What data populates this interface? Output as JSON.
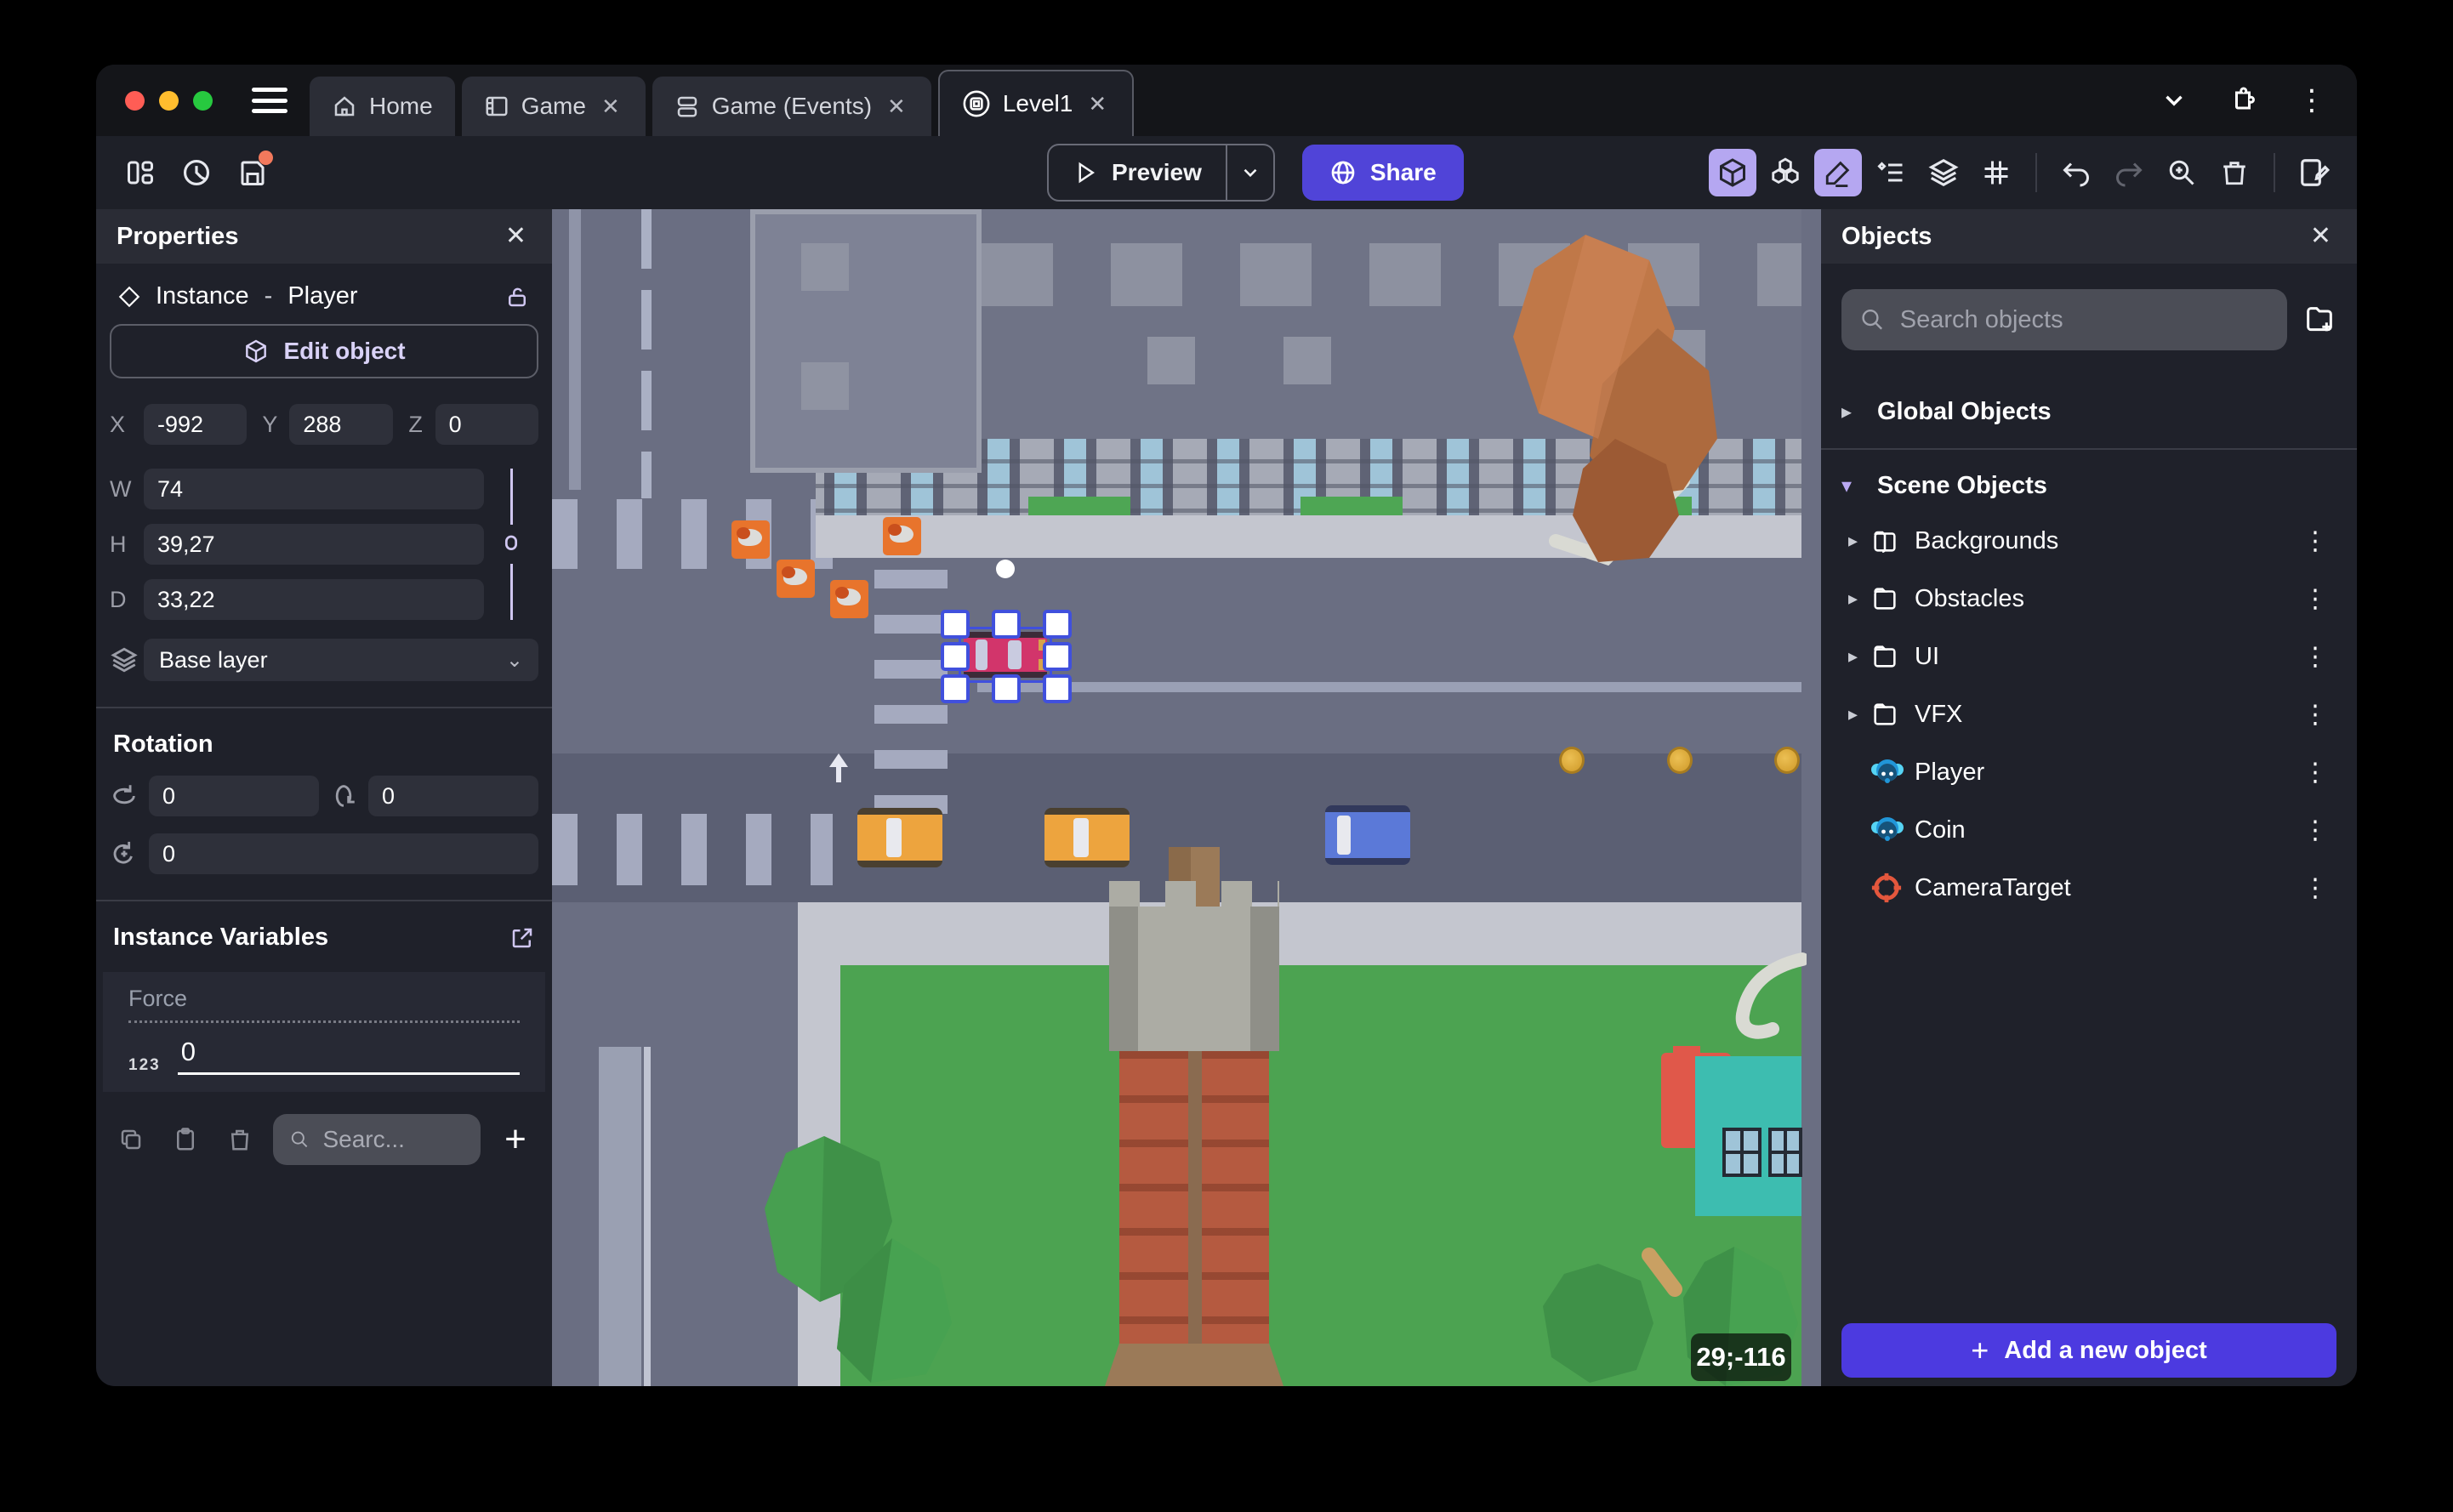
{
  "window": {
    "tabs": [
      {
        "label": "Home",
        "closable": false,
        "active": false
      },
      {
        "label": "Game",
        "closable": true,
        "active": false
      },
      {
        "label": "Game (Events)",
        "closable": true,
        "active": false
      },
      {
        "label": "Level1",
        "closable": true,
        "active": true
      }
    ]
  },
  "toolbar": {
    "preview_label": "Preview",
    "share_label": "Share"
  },
  "properties": {
    "title": "Properties",
    "instance_label": "Instance",
    "separator": "-",
    "object_name": "Player",
    "edit_object_label": "Edit object",
    "x_label": "X",
    "x_value": "-992",
    "y_label": "Y",
    "y_value": "288",
    "z_label": "Z",
    "z_value": "0",
    "w_label": "W",
    "w_value": "74",
    "h_label": "H",
    "h_value": "39,27",
    "d_label": "D",
    "d_value": "33,22",
    "layer_value": "Base layer",
    "rotation_title": "Rotation",
    "rot_x_value": "0",
    "rot_y_value": "0",
    "rot_z_value": "0",
    "variables_title": "Instance Variables",
    "variable_name": "Force",
    "variable_type": "123",
    "variable_value": "0",
    "search_placeholder": "Searc..."
  },
  "objects_panel": {
    "title": "Objects",
    "search_placeholder": "Search objects",
    "global_section_label": "Global Objects",
    "scene_section_label": "Scene Objects",
    "items": [
      {
        "label": "Backgrounds",
        "type": "folder"
      },
      {
        "label": "Obstacles",
        "type": "folder"
      },
      {
        "label": "UI",
        "type": "folder"
      },
      {
        "label": "VFX",
        "type": "folder"
      },
      {
        "label": "Player",
        "type": "model3d"
      },
      {
        "label": "Coin",
        "type": "model3d"
      },
      {
        "label": "CameraTarget",
        "type": "target"
      }
    ],
    "add_button_label": "Add a new object"
  },
  "canvas": {
    "cursor_coordinates": "29;-116"
  },
  "icons": {
    "close": "✕",
    "kebab": "⋮",
    "plus": "+",
    "chevron_down": "⌄",
    "chevron_right": "▸",
    "chevron_down_small": "▾"
  },
  "colors": {
    "accent_purple": "#5044d8",
    "add_button_purple": "#4c3ae0",
    "active_tool_bg": "#b5a7f1",
    "unsaved_dot": "#f2795c",
    "traffic_red": "#ff5d55",
    "traffic_yellow": "#ffbd2e",
    "traffic_green": "#27c93f"
  }
}
